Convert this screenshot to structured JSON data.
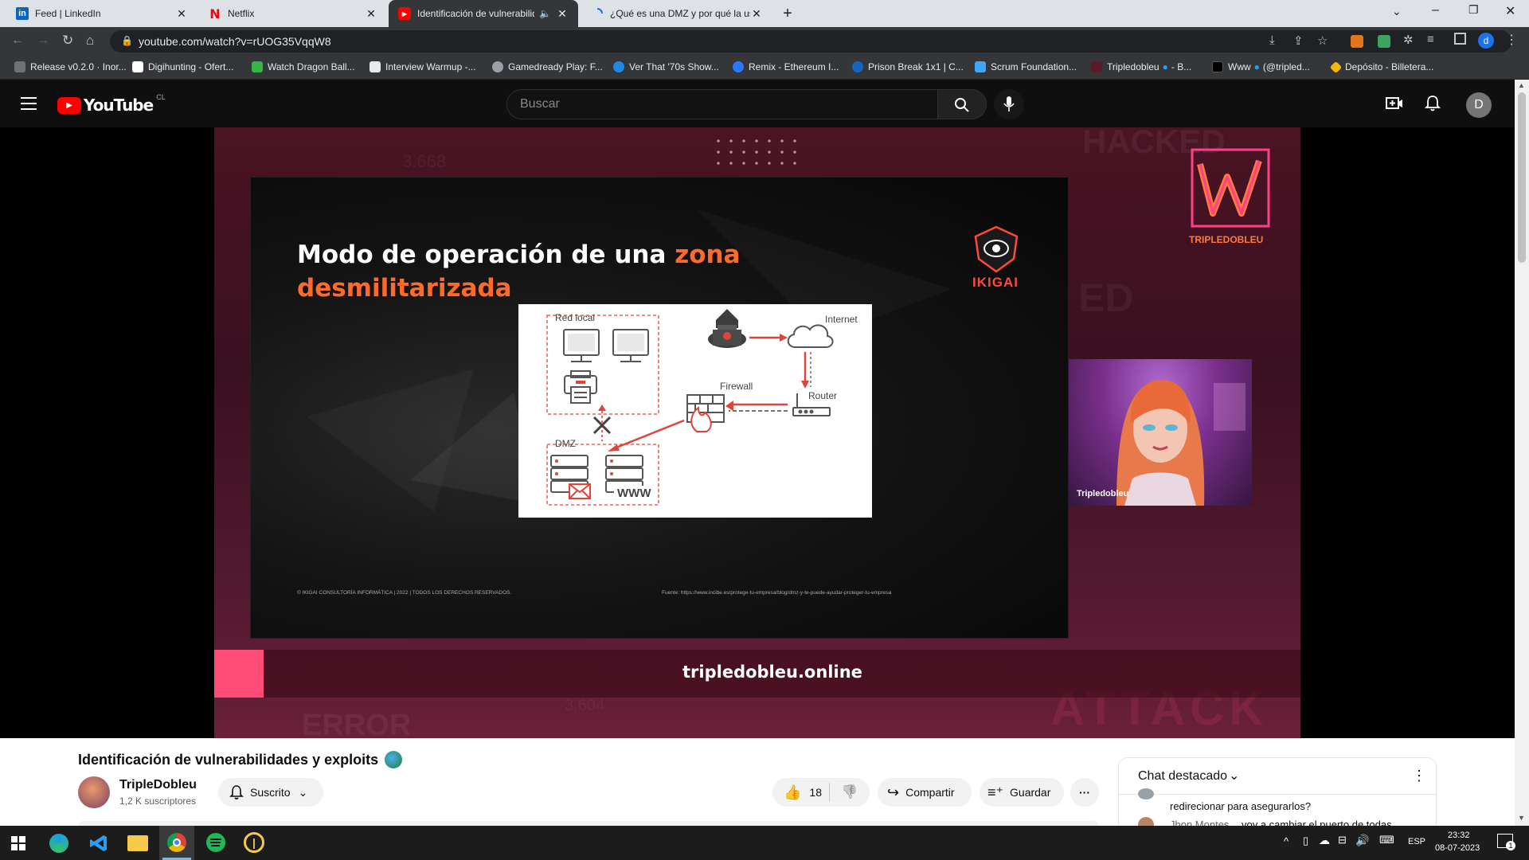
{
  "browser": {
    "tabs": [
      {
        "label": "Feed | LinkedIn",
        "icon": "linkedin-icon"
      },
      {
        "label": "Netflix",
        "icon": "netflix-icon"
      },
      {
        "label": "Identificación de vulnerabilid",
        "icon": "youtube-icon"
      },
      {
        "label": "¿Qué es una DMZ y por qué la us",
        "icon": "loading-icon"
      }
    ],
    "url": "youtube.com/watch?v=rUOG35VqqW8",
    "bookmarks": [
      "Release v0.2.0 · Inor...",
      "Digihunting - Ofert...",
      "Watch Dragon Ball...",
      "Interview Warmup -...",
      "Gamedready Play: F...",
      "Ver That '70s Show...",
      "Remix - Ethereum I...",
      "Prison Break 1x1 | C...",
      "Scrum Foundation...",
      "Tripledobleu",
      "Www",
      "Depósito - Billetera..."
    ],
    "bookmark_suffix_1": "- B...",
    "bookmark_suffix_2": "(@tripled...",
    "profile_initial": "d"
  },
  "youtube": {
    "logo_text": "YouTube",
    "country": "CL",
    "search_placeholder": "Buscar",
    "avatar_initial": "D"
  },
  "video": {
    "slide_title_white": "Modo de operación de una",
    "slide_title_orange": "zona",
    "slide_title_orange2": "desmilitarizada",
    "brand_ikigai": "IKIGAI",
    "brand_tripledobleu": "TRIPLEDOBLEU",
    "diagram": {
      "red_local": "Red local",
      "internet": "Internet",
      "firewall": "Firewall",
      "router": "Router",
      "dmz": "DMZ",
      "www": "WWW"
    },
    "footer_left": "© IKIGAI CONSULTORÍA INFORMÁTICA | 2022 | TODOS LOS DERECHOS RESERVADOS.",
    "footer_right": "Fuente: https://www.incibe.es/protege-tu-empresa/blog/dmz-y-te-puede-ayudar-proteger-tu-empresa",
    "webcam_label": "Tripledobleu",
    "website": "tripledobleu.online",
    "bg_words": [
      "HACKED",
      "ERROR",
      "ATTACK",
      "3.604",
      "3.668",
      "ED"
    ]
  },
  "meta": {
    "title": "Identificación de vulnerabilidades y exploits",
    "channel": "TripleDobleu",
    "subscribers": "1,2 K suscriptores",
    "subscribe_label": "Suscrito",
    "likes": "18",
    "share_label": "Compartir",
    "save_label": "Guardar"
  },
  "chat": {
    "title": "Chat destacado",
    "msg1": "redirecionar para asegurarlos?",
    "msg2_author": "Jhon Montes",
    "msg2_text": "voy a cambiar el puerto de todas"
  },
  "taskbar": {
    "language": "ESP",
    "time": "23:32",
    "date": "08-07-2023",
    "notification_count": "1"
  },
  "colors": {
    "youtube_red": "#ff0000",
    "accent_orange": "#ff6a2b",
    "diagram_red": "#e0433a",
    "brand_pink": "#ff3f87",
    "webcam_bg": "#7a2f8c"
  }
}
